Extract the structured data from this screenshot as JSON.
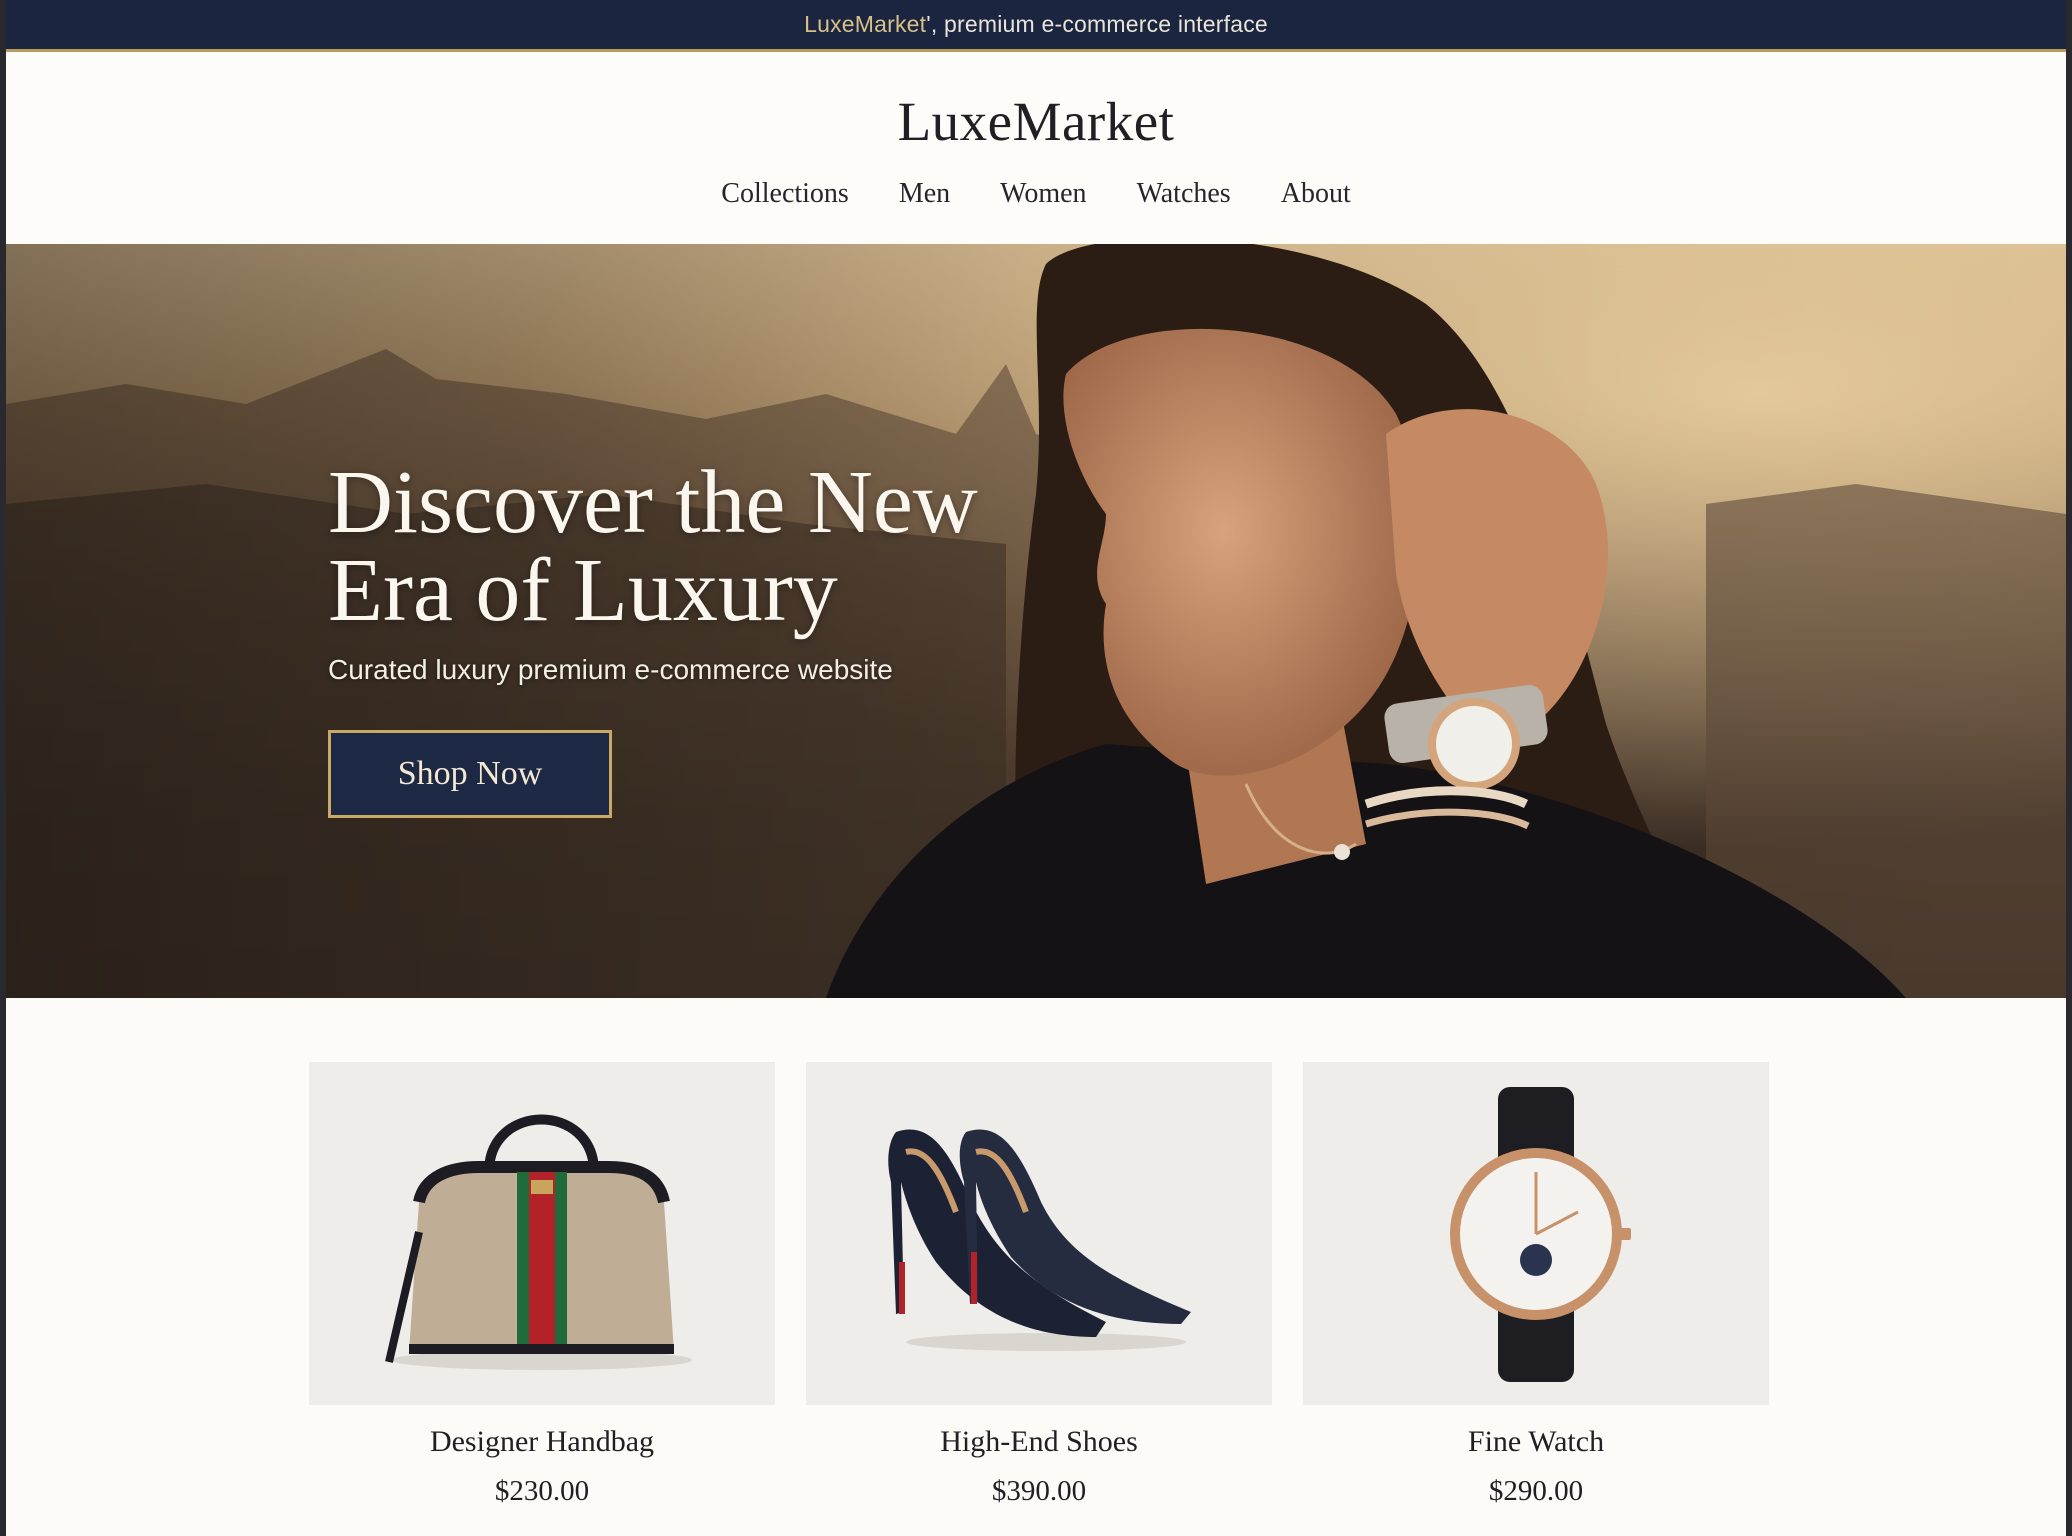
{
  "topbar": {
    "brand": "LuxeMarket",
    "text": "', premium e-commerce interface"
  },
  "header": {
    "logo": "LuxeMarket"
  },
  "nav": {
    "items": [
      {
        "label": "Collections"
      },
      {
        "label": "Men"
      },
      {
        "label": "Women"
      },
      {
        "label": "Watches"
      },
      {
        "label": "About"
      }
    ]
  },
  "hero": {
    "title_line1": "Discover the New",
    "title_line2": "Era of Luxury",
    "subtitle": "Curated luxury premium e-commerce website",
    "cta_label": "Shop Now"
  },
  "products": [
    {
      "name": "Designer Handbag",
      "price": "$230.00",
      "icon": "handbag-image"
    },
    {
      "name": "High-End Shoes",
      "price": "$390.00",
      "icon": "shoes-image"
    },
    {
      "name": "Fine Watch",
      "price": "$290.00",
      "icon": "watch-image"
    }
  ],
  "colors": {
    "navy": "#1b2540",
    "gold": "#c9a964",
    "page_bg": "#fcfbf8"
  }
}
